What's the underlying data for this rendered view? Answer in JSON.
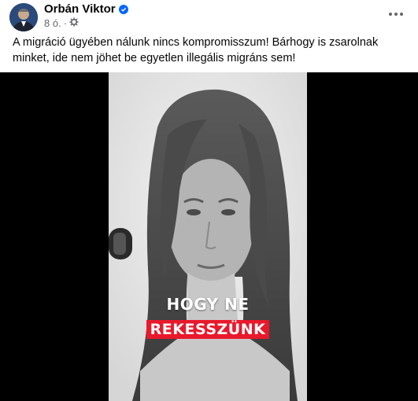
{
  "post": {
    "author": "Orbán Viktor",
    "time": "8 ó.",
    "separator": "·",
    "text": "A  migráció ügyében nálunk nincs kompromisszum! Bárhogy is zsarolnak minket, ide nem jöhet be egyetlen illegális migráns sem!"
  },
  "video": {
    "caption_line1": "HOGY NE",
    "caption_line2": "REKESSZÜNK"
  },
  "icons": {
    "verified": "verified-badge-icon",
    "audience": "globe-gear-icon",
    "more": "more-options-icon"
  },
  "colors": {
    "brand_blue": "#0866ff",
    "caption_red": "#e8192c",
    "meta_gray": "#65676b"
  }
}
